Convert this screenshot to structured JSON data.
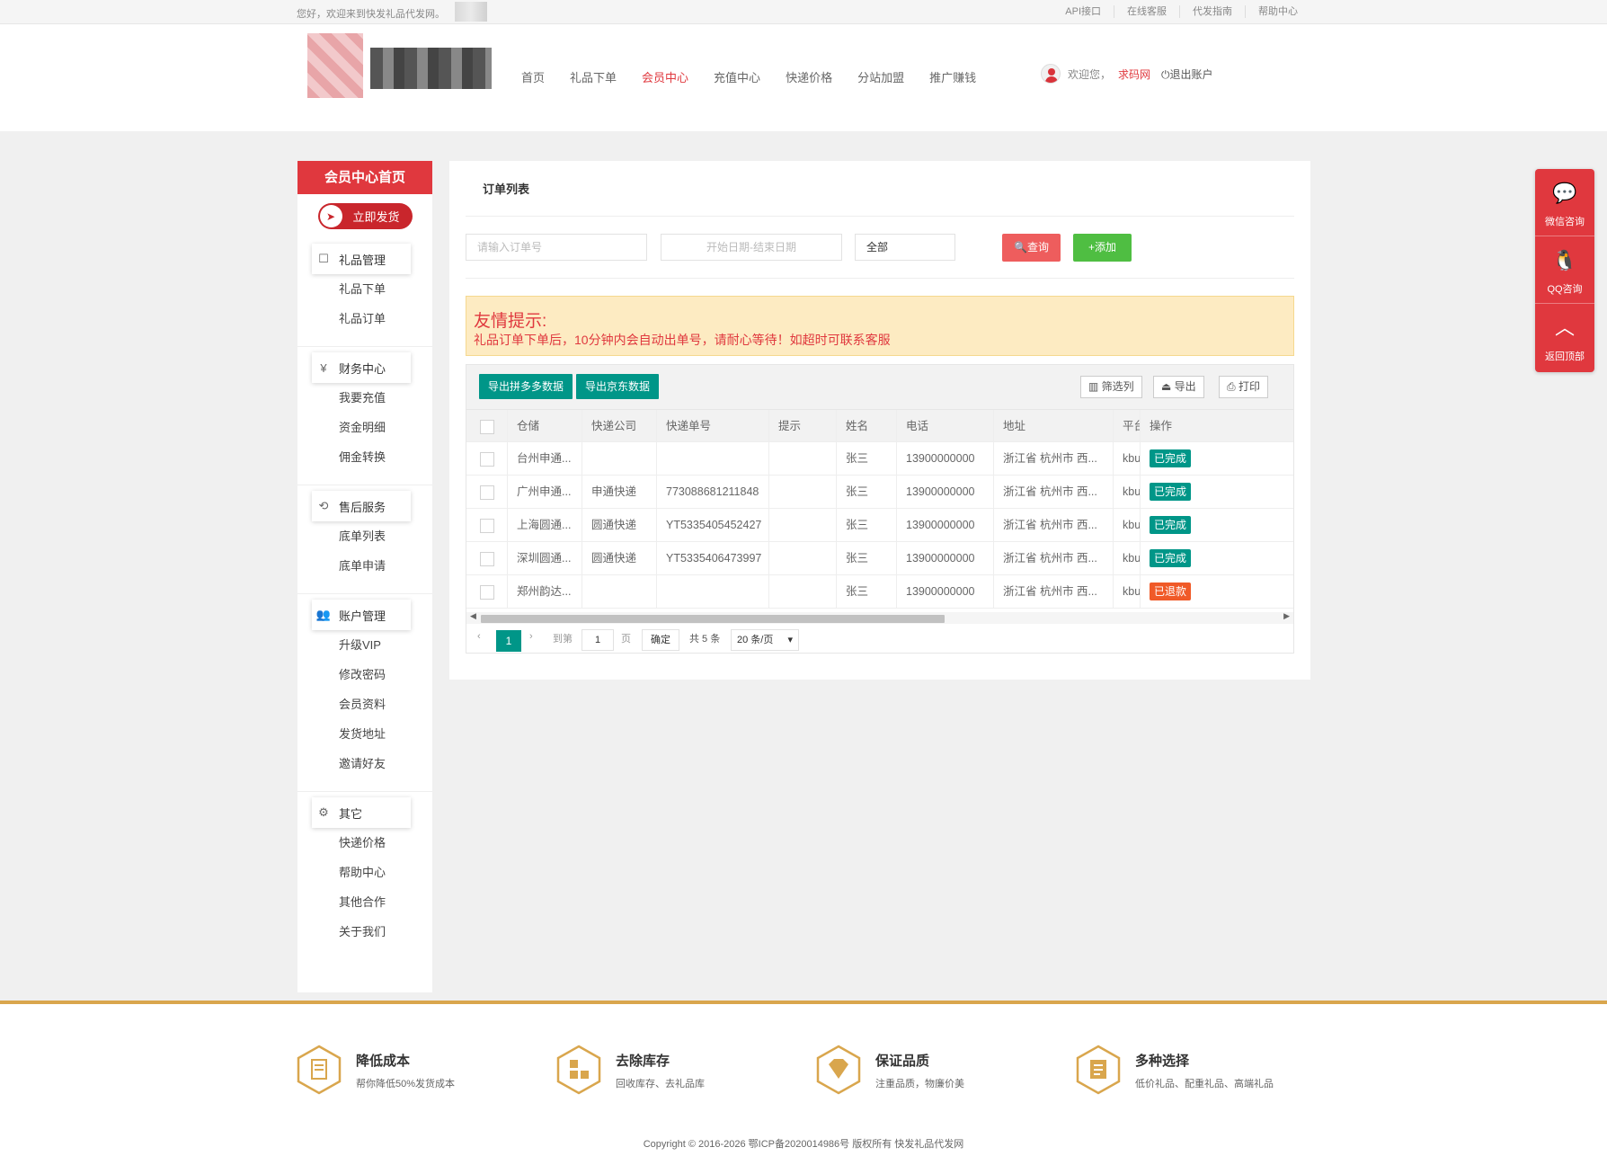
{
  "topbar": {
    "greeting": "您好，欢迎来到快发礼品代发网。",
    "links": [
      "API接口",
      "在线客服",
      "代发指南",
      "帮助中心"
    ]
  },
  "nav": {
    "items": [
      "首页",
      "礼品下单",
      "会员中心",
      "充值中心",
      "快递价格",
      "分站加盟",
      "推广赚钱"
    ],
    "active_index": 2
  },
  "user": {
    "welcome": "欢迎您，",
    "name": "求码网",
    "logout": "退出账户"
  },
  "sidebar": {
    "header": "会员中心首页",
    "ship_button": "立即发货",
    "groups": [
      {
        "title": "礼品管理",
        "icon": "bag-icon",
        "items": [
          "礼品下单",
          "礼品订单"
        ]
      },
      {
        "title": "财务中心",
        "icon": "yen-icon",
        "items": [
          "我要充值",
          "资金明细",
          "佣金转换"
        ]
      },
      {
        "title": "售后服务",
        "icon": "refresh-icon",
        "items": [
          "底单列表",
          "底单申请"
        ]
      },
      {
        "title": "账户管理",
        "icon": "users-icon",
        "items": [
          "升级VIP",
          "修改密码",
          "会员资料",
          "发货地址",
          "邀请好友"
        ]
      },
      {
        "title": "其它",
        "icon": "gear-icon",
        "items": [
          "快递价格",
          "帮助中心",
          "其他合作",
          "关于我们"
        ]
      }
    ]
  },
  "main": {
    "title": "订单列表",
    "search": {
      "order_placeholder": "请输入订单号",
      "date_placeholder": "开始日期-结束日期",
      "status_value": "全部",
      "query_label": "查询",
      "add_label": "+添加"
    },
    "notice": {
      "heading": "友情提示:",
      "text": "礼品订单下单后，10分钟内会自动出单号，请耐心等待！如超时可联系客服"
    },
    "toolbar": {
      "export_pdd": "导出拼多多数据",
      "export_jd": "导出京东数据",
      "filter_cols": "筛选列",
      "export": "导出",
      "print": "打印"
    },
    "table": {
      "columns": [
        "仓储",
        "快递公司",
        "快递单号",
        "提示",
        "姓名",
        "电话",
        "地址",
        "平台",
        "操作"
      ],
      "rows": [
        {
          "warehouse": "台州申通...",
          "courier": "",
          "tracking": "",
          "tip": "",
          "name": "张三",
          "phone": "13900000000",
          "address": "浙江省 杭州市 西...",
          "platform": "kbu",
          "status": "已完成",
          "status_color": "#009688"
        },
        {
          "warehouse": "广州申通...",
          "courier": "申通快递",
          "tracking": "773088681211848",
          "tip": "",
          "name": "张三",
          "phone": "13900000000",
          "address": "浙江省 杭州市 西...",
          "platform": "kbu",
          "status": "已完成",
          "status_color": "#009688"
        },
        {
          "warehouse": "上海圆通...",
          "courier": "圆通快递",
          "tracking": "YT5335405452427",
          "tip": "",
          "name": "张三",
          "phone": "13900000000",
          "address": "浙江省 杭州市 西...",
          "platform": "kbu",
          "status": "已完成",
          "status_color": "#009688"
        },
        {
          "warehouse": "深圳圆通...",
          "courier": "圆通快递",
          "tracking": "YT5335406473997",
          "tip": "",
          "name": "张三",
          "phone": "13900000000",
          "address": "浙江省 杭州市 西...",
          "platform": "kbu",
          "status": "已完成",
          "status_color": "#009688"
        },
        {
          "warehouse": "郑州韵达...",
          "courier": "",
          "tracking": "",
          "tip": "",
          "name": "张三",
          "phone": "13900000000",
          "address": "浙江省 杭州市 西...",
          "platform": "kbu",
          "status": "已退款",
          "status_color": "#f05a28"
        }
      ]
    },
    "pager": {
      "current": "1",
      "goto": "到第",
      "page_input": "1",
      "page_unit": "页",
      "confirm": "确定",
      "total": "共 5 条",
      "page_size": "20 条/页"
    }
  },
  "float_bar": [
    {
      "label": "微信咨询",
      "icon": "wechat-icon"
    },
    {
      "label": "QQ咨询",
      "icon": "qq-icon"
    },
    {
      "label": "返回顶部",
      "icon": "arrow-up-icon"
    }
  ],
  "footer": {
    "features": [
      {
        "title": "降低成本",
        "desc": "帮你降低50%发货成本"
      },
      {
        "title": "去除库存",
        "desc": "回收库存、去礼品库"
      },
      {
        "title": "保证品质",
        "desc": "注重品质，物廉价美"
      },
      {
        "title": "多种选择",
        "desc": "低价礼品、配重礼品、高端礼品"
      }
    ],
    "copyright": "Copyright © 2016-2026 鄂ICP备2020014986号 版权所有 快发礼品代发网"
  },
  "colors": {
    "brand_red": "#e0383e",
    "teal": "#009688",
    "green": "#4fbe42",
    "gold": "#d9a64d"
  }
}
